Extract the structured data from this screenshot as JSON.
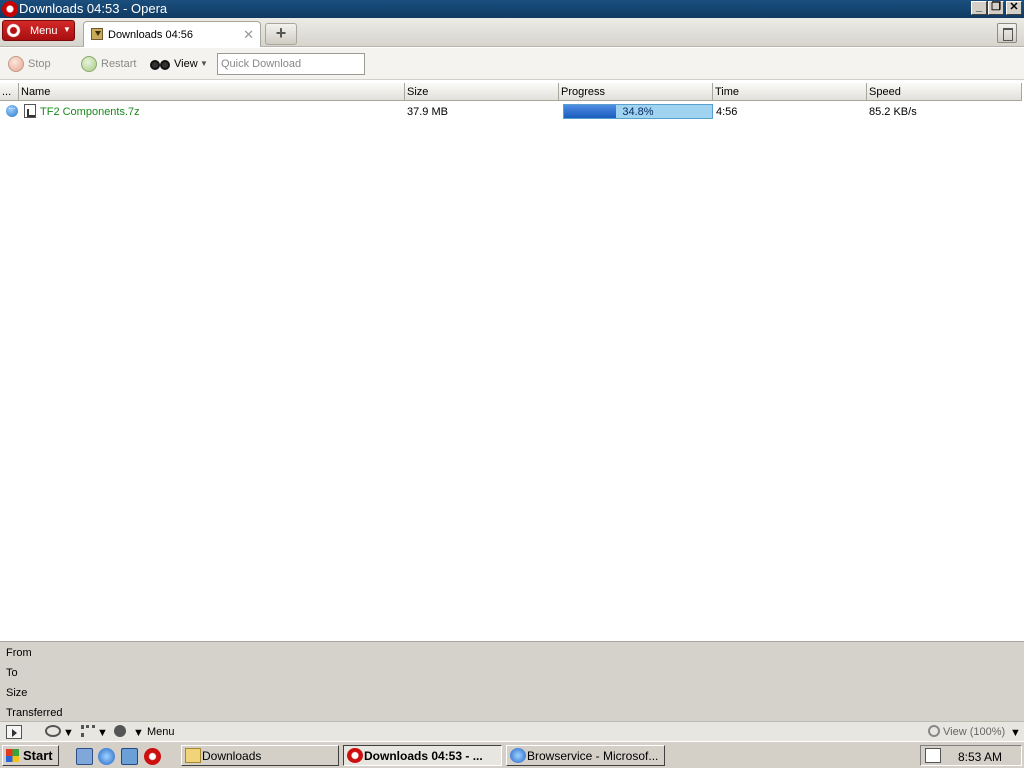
{
  "window": {
    "title": "Downloads 04:53 - Opera",
    "minimize": "_",
    "maximize": "❐",
    "close": "✕"
  },
  "tabbar": {
    "menu_label": "Menu",
    "menu_arrow": "▼",
    "active_tab": "Downloads 04:56",
    "tab_close": "✕",
    "new_tab": "+"
  },
  "toolbar": {
    "stop_label": "Stop",
    "restart_label": "Restart",
    "view_label": "View",
    "view_arrow": "▼",
    "quick_download_placeholder": "Quick Download"
  },
  "table": {
    "columns": [
      "...",
      "Name",
      "Size",
      "Progress",
      "Time",
      "Speed"
    ],
    "rows": [
      {
        "name": "TF2 Components.7z",
        "size": "37.9 MB",
        "progress_text": "34.8%",
        "progress": 0.348,
        "time": "4:56",
        "speed": "85.2 KB/s"
      }
    ]
  },
  "details": {
    "from_label": "From",
    "to_label": "To",
    "size_label": "Size",
    "transferred_label": "Transferred"
  },
  "statusbar": {
    "menu_label": "Menu",
    "zoom_label": "View (100%)",
    "arrow": "▼"
  },
  "taskbar": {
    "start_label": "Start",
    "tasks": [
      {
        "label": "Downloads",
        "active": false
      },
      {
        "label": "Downloads 04:53 - ...",
        "active": true
      },
      {
        "label": "Browservice - Microsof...",
        "active": false
      }
    ],
    "clock": "8:53 AM"
  },
  "colors": {
    "titlebar": "#1c4f7e",
    "menu_button": "#c11b1b",
    "filename": "#1a8a1a",
    "progress_fill": "#1b5bbd",
    "progress_track": "#9fd3f0"
  },
  "icons": {
    "opera": "opera-logo-icon",
    "stop": "stop-icon",
    "restart": "restart-icon",
    "view": "binoculars-icon",
    "trash": "trash-icon"
  }
}
